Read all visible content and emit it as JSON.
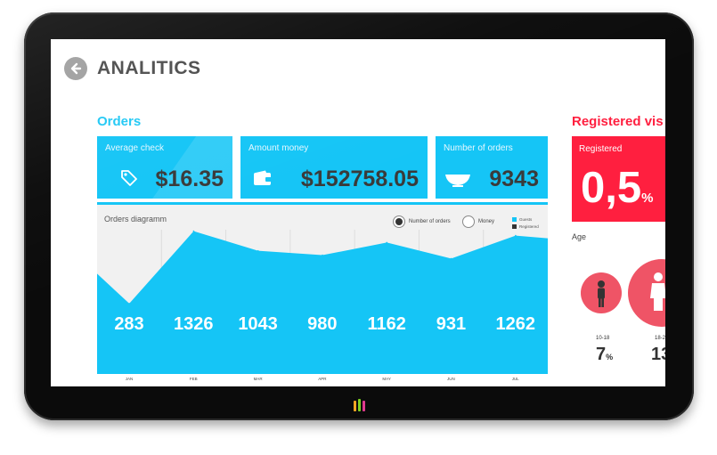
{
  "page": {
    "title": "ANALITICS"
  },
  "orders": {
    "section_title": "Orders",
    "cards": [
      {
        "label": "Average check",
        "value": "$16.35",
        "icon": "price-tag-icon"
      },
      {
        "label": "Amount money",
        "value": "$152758.05",
        "icon": "wallet-icon"
      },
      {
        "label": "Number of orders",
        "value": "9343",
        "icon": "bowl-icon"
      }
    ]
  },
  "diagram": {
    "title": "Orders diagramm",
    "toggle": [
      {
        "label": "Number of orders",
        "selected": true
      },
      {
        "label": "Money",
        "selected": false
      }
    ],
    "legend": [
      {
        "label": "Guests",
        "color": "#15c5f6"
      },
      {
        "label": "Registered",
        "color": "#333333"
      }
    ]
  },
  "chart_data": {
    "type": "area",
    "title": "Orders diagramm",
    "categories": [
      "JAN",
      "FEB",
      "MAR",
      "APR",
      "MAY",
      "JUN",
      "JUL"
    ],
    "series": [
      {
        "name": "Guests",
        "values": [
          283,
          1326,
          1043,
          980,
          1162,
          931,
          1262
        ]
      }
    ],
    "data_labels": [
      "283",
      "1326",
      "1043",
      "980",
      "1162",
      "931",
      "1262"
    ],
    "grid": true,
    "legend_position": "top-right",
    "color": "#15c5f6"
  },
  "registered": {
    "section_title": "Registered vis",
    "card_label": "Registered",
    "big_value": "0,5",
    "big_unit": "%",
    "age_title": "Age",
    "age_groups": [
      {
        "range": "10-18",
        "value": "7",
        "unit": "%"
      },
      {
        "range": "18-2",
        "value": "13",
        "unit": ""
      }
    ]
  },
  "colors": {
    "accent_blue": "#15c5f6",
    "accent_red": "#ff1f3f",
    "bezel": "#0b0b0b"
  }
}
